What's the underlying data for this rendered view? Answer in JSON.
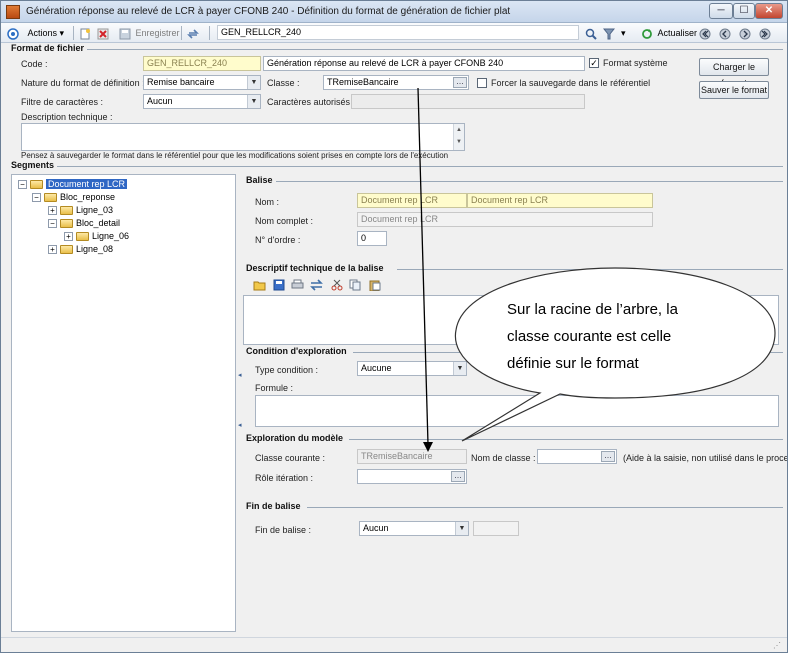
{
  "window": {
    "title": "Génération réponse au relevé de LCR à payer CFONB 240 -  Définition du format de génération de fichier plat",
    "minimize": "─",
    "maximize": "☐",
    "close": "✕"
  },
  "toolbar": {
    "actions_label": "Actions",
    "save_label": "Enregistrer",
    "search_value": "GEN_RELLCR_240",
    "refresh_label": "Actualiser"
  },
  "format": {
    "section_label": "Format de fichier",
    "code_label": "Code :",
    "code_value": "GEN_RELLCR_240",
    "description_value": "Génération réponse au relevé de LCR à payer CFONB 240",
    "system_format_label": "Format système",
    "system_format_checked": true,
    "nature_label": "Nature du format de définition :",
    "nature_value": "Remise bancaire",
    "class_label": "Classe :",
    "class_value": "TRemiseBancaire",
    "force_save_label": "Forcer la sauvegarde dans le référentiel",
    "force_save_checked": false,
    "char_filter_label": "Filtre de caractères :",
    "char_filter_value": "Aucun",
    "allowed_chars_label": "Caractères autorisés :",
    "allowed_chars_value": "",
    "tech_desc_label": "Description technique :",
    "tech_desc_value": "",
    "hint": "Pensez à sauvegarder le format dans le référentiel pour que les modifications soient prises en compte lors de l'exécution",
    "load_button": "Charger le format",
    "save_button": "Sauver le format"
  },
  "segments": {
    "section_label": "Segments",
    "tree": [
      {
        "label": "Document rep LCR",
        "level": 0,
        "expander": "−",
        "selected": true
      },
      {
        "label": "Bloc_reponse",
        "level": 1,
        "expander": "−",
        "selected": false
      },
      {
        "label": "Ligne_03",
        "level": 2,
        "expander": "+",
        "selected": false
      },
      {
        "label": "Bloc_detail",
        "level": 2,
        "expander": "−",
        "selected": false
      },
      {
        "label": "Ligne_06",
        "level": 3,
        "expander": "+",
        "selected": false
      },
      {
        "label": "Ligne_08",
        "level": 2,
        "expander": "+",
        "selected": false
      }
    ]
  },
  "balise": {
    "section_label": "Balise",
    "nom_label": "Nom :",
    "nom_value_1": "Document rep LCR",
    "nom_value_2": "Document rep LCR",
    "nom_complet_label": "Nom complet :",
    "nom_complet_value": "Document rep LCR",
    "ordre_label": "N° d'ordre :",
    "ordre_value": "0"
  },
  "descriptif": {
    "section_label": "Descriptif technique de la balise",
    "value": ""
  },
  "condition": {
    "section_label": "Condition d'exploration",
    "type_label": "Type condition :",
    "type_value": "Aucune",
    "formule_label": "Formule :",
    "formule_value": ""
  },
  "exploration": {
    "section_label": "Exploration du modèle",
    "classe_courante_label": "Classe courante :",
    "classe_courante_value": "TRemiseBancaire",
    "nom_classe_label": "Nom de classe :",
    "nom_classe_value": "",
    "aide_text": "(Aide à la saisie, non utilisé dans le proces",
    "role_label": "Rôle itération :",
    "role_value": ""
  },
  "fin": {
    "section_label": "Fin de balise",
    "fin_label": "Fin de balise :",
    "fin_value": "Aucun",
    "extra_value": ""
  },
  "callout": {
    "line1": "Sur la racine de l’arbre, la",
    "line2": "classe courante est celle",
    "line3": "définie sur le format"
  },
  "colors": {
    "selection": "#2f67c4",
    "readonly_yellow": "#fffccc",
    "titlebar": "#c5d5ea"
  }
}
